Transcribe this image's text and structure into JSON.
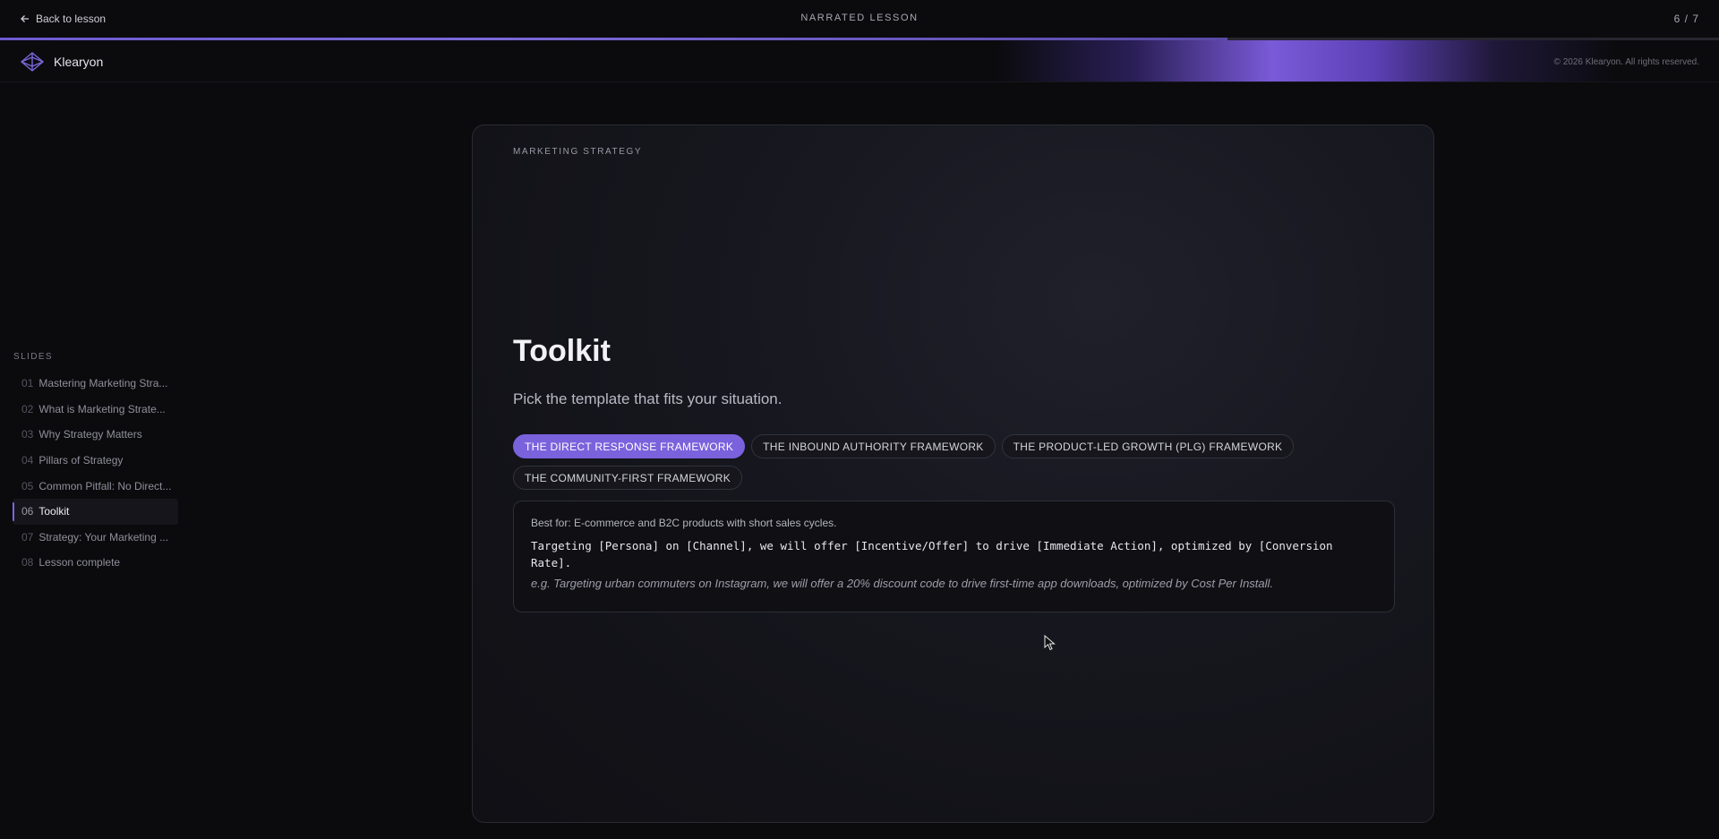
{
  "topbar": {
    "back_label": "Back to lesson",
    "title": "NARRATED LESSON",
    "counter": "6 / 7",
    "progress": 0.714
  },
  "brand": {
    "name": "Klearyon",
    "copyright": "© 2026 Klearyon. All rights reserved."
  },
  "sidebar": {
    "heading": "SLIDES",
    "items": [
      {
        "num": "01",
        "label": "Mastering Marketing Stra..."
      },
      {
        "num": "02",
        "label": "What is Marketing Strate..."
      },
      {
        "num": "03",
        "label": "Why Strategy Matters"
      },
      {
        "num": "04",
        "label": "Pillars of Strategy"
      },
      {
        "num": "05",
        "label": "Common Pitfall: No Direct..."
      },
      {
        "num": "06",
        "label": "Toolkit",
        "active": true
      },
      {
        "num": "07",
        "label": "Strategy: Your Marketing ..."
      },
      {
        "num": "08",
        "label": "Lesson complete"
      }
    ]
  },
  "slide": {
    "eyebrow": "MARKETING STRATEGY",
    "title": "Toolkit",
    "subtitle": "Pick the template that fits your situation.",
    "tabs": [
      {
        "label": "THE DIRECT RESPONSE FRAMEWORK",
        "active": true
      },
      {
        "label": "THE INBOUND AUTHORITY FRAMEWORK"
      },
      {
        "label": "THE PRODUCT-LED GROWTH (PLG) FRAMEWORK"
      },
      {
        "label": "THE COMMUNITY-FIRST FRAMEWORK"
      }
    ],
    "template": {
      "best_for": "Best for: E-commerce and B2C products with short sales cycles.",
      "text": "Targeting [Persona] on [Channel], we will offer [Incentive/Offer] to drive [Immediate Action], optimized by [Conversion Rate].",
      "example": "e.g. Targeting urban commuters on Instagram, we will offer a 20% discount code to drive first-time app downloads, optimized by Cost Per Install."
    }
  },
  "colors": {
    "accent": "#7a62dc",
    "background": "#0b0b0e"
  }
}
